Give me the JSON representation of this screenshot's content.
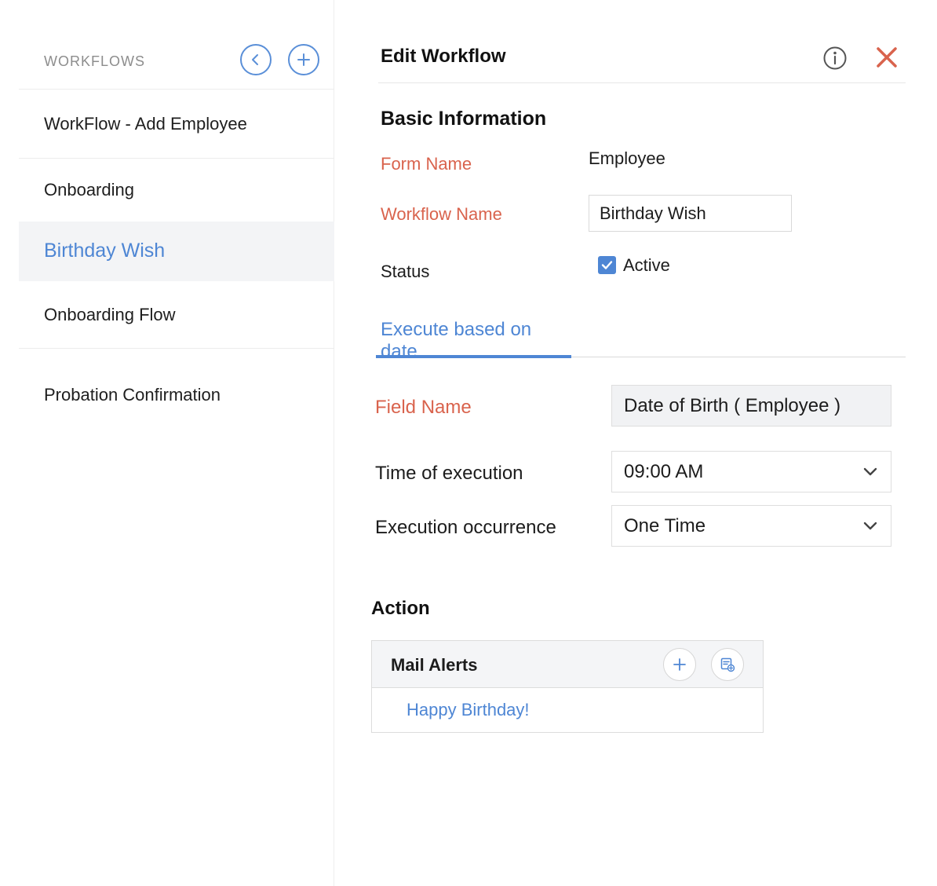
{
  "sidebar": {
    "title": "WORKFLOWS",
    "back_icon": "chevron-left-icon",
    "add_icon": "plus-icon",
    "items": [
      {
        "label": "WorkFlow - Add Employee"
      },
      {
        "label": "Onboarding"
      },
      {
        "label": "Birthday Wish",
        "active": true
      },
      {
        "label": "Onboarding Flow"
      },
      {
        "label": "Probation Confirmation"
      }
    ]
  },
  "header": {
    "title": "Edit Workflow",
    "info_icon": "info-icon",
    "close_icon": "close-icon"
  },
  "basic_info": {
    "title": "Basic Information",
    "form_name_label": "Form Name",
    "form_name_value": "Employee",
    "workflow_name_label": "Workflow Name",
    "workflow_name_value": "Birthday Wish",
    "status_label": "Status",
    "status_value": "Active",
    "status_checked": true
  },
  "tabs": [
    {
      "label": "Execute based on date",
      "active": true
    }
  ],
  "execution": {
    "field_name_label": "Field Name",
    "field_name_value": "Date of Birth ( Employee )",
    "time_label": "Time of execution",
    "time_value": "09:00 AM",
    "occurrence_label": "Execution occurrence",
    "occurrence_value": "One Time"
  },
  "action": {
    "title": "Action",
    "mail_alerts_label": "Mail Alerts",
    "items": [
      {
        "label": "Happy Birthday!"
      }
    ]
  },
  "colors": {
    "accent": "#4e86d4",
    "required": "#d9634d",
    "close": "#d9634d"
  }
}
